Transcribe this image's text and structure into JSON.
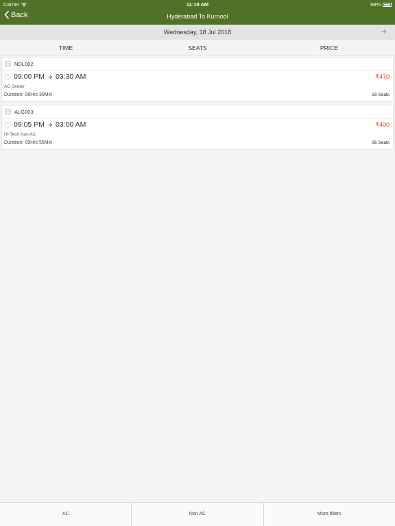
{
  "status": {
    "carrier": "Carrier",
    "time": "11:19 AM",
    "battery": "98%"
  },
  "nav": {
    "back_label": "Back",
    "title": "Hyderabad To Kurnool"
  },
  "date": {
    "label": "Wednesday, 18 Jul 2018"
  },
  "sort": {
    "time": "TIME",
    "seats": "SEATS",
    "price": "PRICE"
  },
  "buses": [
    {
      "code": "NDL002",
      "depart": "09:00 PM",
      "arrive": "03:30 AM",
      "price": "₹470",
      "type": "AC Seater",
      "duration": "Duration: 06Hrs 30Min",
      "seats": "26 Seats"
    },
    {
      "code": "ALG003",
      "depart": "09:05 PM",
      "arrive": "03:00 AM",
      "price": "₹400",
      "type": "Hi-Tech Non AC",
      "duration": "Duration: 05Hrs 55Min",
      "seats": "36 Seats"
    }
  ],
  "filters": {
    "ac": "AC",
    "non_ac": "Non AC",
    "more": "More filters"
  },
  "colors": {
    "header": "#4f7226",
    "price": "#e8491e"
  }
}
